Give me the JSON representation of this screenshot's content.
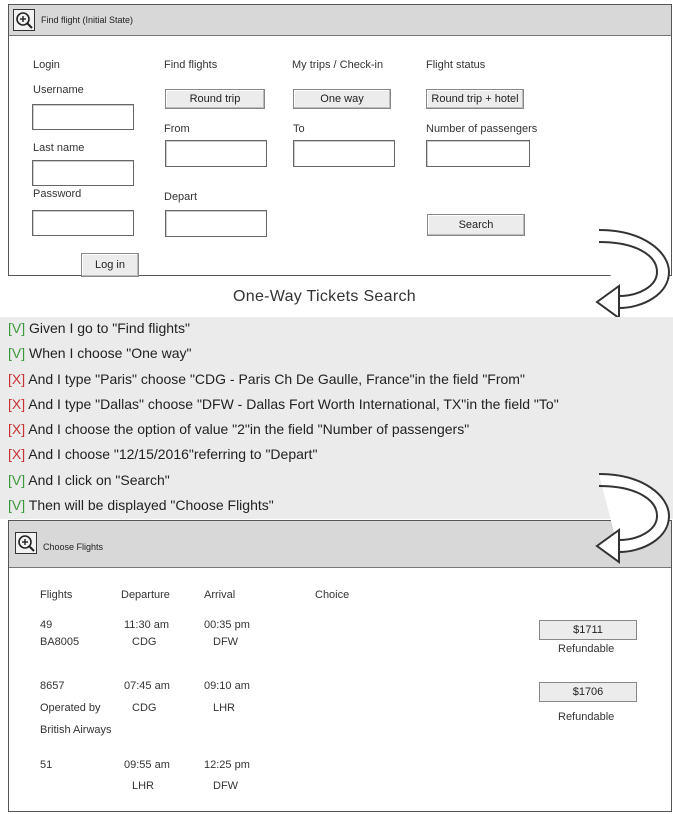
{
  "top_window": {
    "title": "Find flight  (Initial State)",
    "columns": {
      "login": "Login",
      "find_flights": "Find flights",
      "my_trips": "My trips / Check-in",
      "flight_status": "Flight status"
    },
    "fields": {
      "username": "Username",
      "last_name": "Last name",
      "password": "Password",
      "from": "From",
      "to": "To",
      "depart": "Depart",
      "number_of_passengers": "Number of passengers"
    },
    "buttons": {
      "round_trip": "Round trip",
      "one_way": "One way",
      "round_trip_hotel": "Round trip + hotel",
      "search": "Search",
      "log_in": "Log in"
    }
  },
  "scenario": {
    "title": "One-Way Tickets Search",
    "steps": [
      {
        "marker": "[V]",
        "status": "pass",
        "text": "Given I go to \"Find flights\""
      },
      {
        "marker": "[V]",
        "status": "pass",
        "text": "When I choose \"One way\""
      },
      {
        "marker": "[X]",
        "status": "fail",
        "text": "And I type \"Paris\" choose \"CDG - Paris Ch De Gaulle, France\"in the field \"From\""
      },
      {
        "marker": "[X]",
        "status": "fail",
        "text": "And I type \"Dallas\" choose \"DFW - Dallas Fort Worth International, TX\"in the field \"To\""
      },
      {
        "marker": "[X]",
        "status": "fail",
        "text": "And I choose the option of value \"2\"in the field \"Number of passengers\""
      },
      {
        "marker": "[X]",
        "status": "fail",
        "text": "And I choose \"12/15/2016\"referring to \"Depart\""
      },
      {
        "marker": "[V]",
        "status": "pass",
        "text": "And I click on \"Search\""
      },
      {
        "marker": "[V]",
        "status": "pass",
        "text": "Then will be displayed \"Choose Flights\""
      }
    ]
  },
  "bottom_window": {
    "title": "Choose Flights",
    "headers": {
      "flights": "Flights",
      "departure": "Departure",
      "arrival": "Arrival",
      "choice": "Choice"
    },
    "flights": [
      {
        "number": "49",
        "carrier": "BA8005",
        "dep_time": "11:30 am",
        "dep_airport": "CDG",
        "arr_time": "00:35 pm",
        "arr_airport": "DFW",
        "price": "$1711",
        "refundable": "Refundable"
      },
      {
        "number": "8657",
        "carrier": "Operated by",
        "carrier2": "British Airways",
        "dep_time": "07:45 am",
        "dep_airport": "CDG",
        "arr_time": "09:10 am",
        "arr_airport": "LHR",
        "price": "$1706",
        "refundable": "Refundable"
      },
      {
        "number": "51",
        "dep_time": "09:55 am",
        "dep_airport": "LHR",
        "arr_time": "12:25 pm",
        "arr_airport": "DFW"
      }
    ]
  },
  "colors": {
    "pass": "#3a9a3a",
    "fail": "#c83232",
    "steps_background": "#ebebeb",
    "titlebar": "#d8d8d8"
  },
  "icons": [
    "zoom-in-icon",
    "curved-arrow-icon"
  ]
}
